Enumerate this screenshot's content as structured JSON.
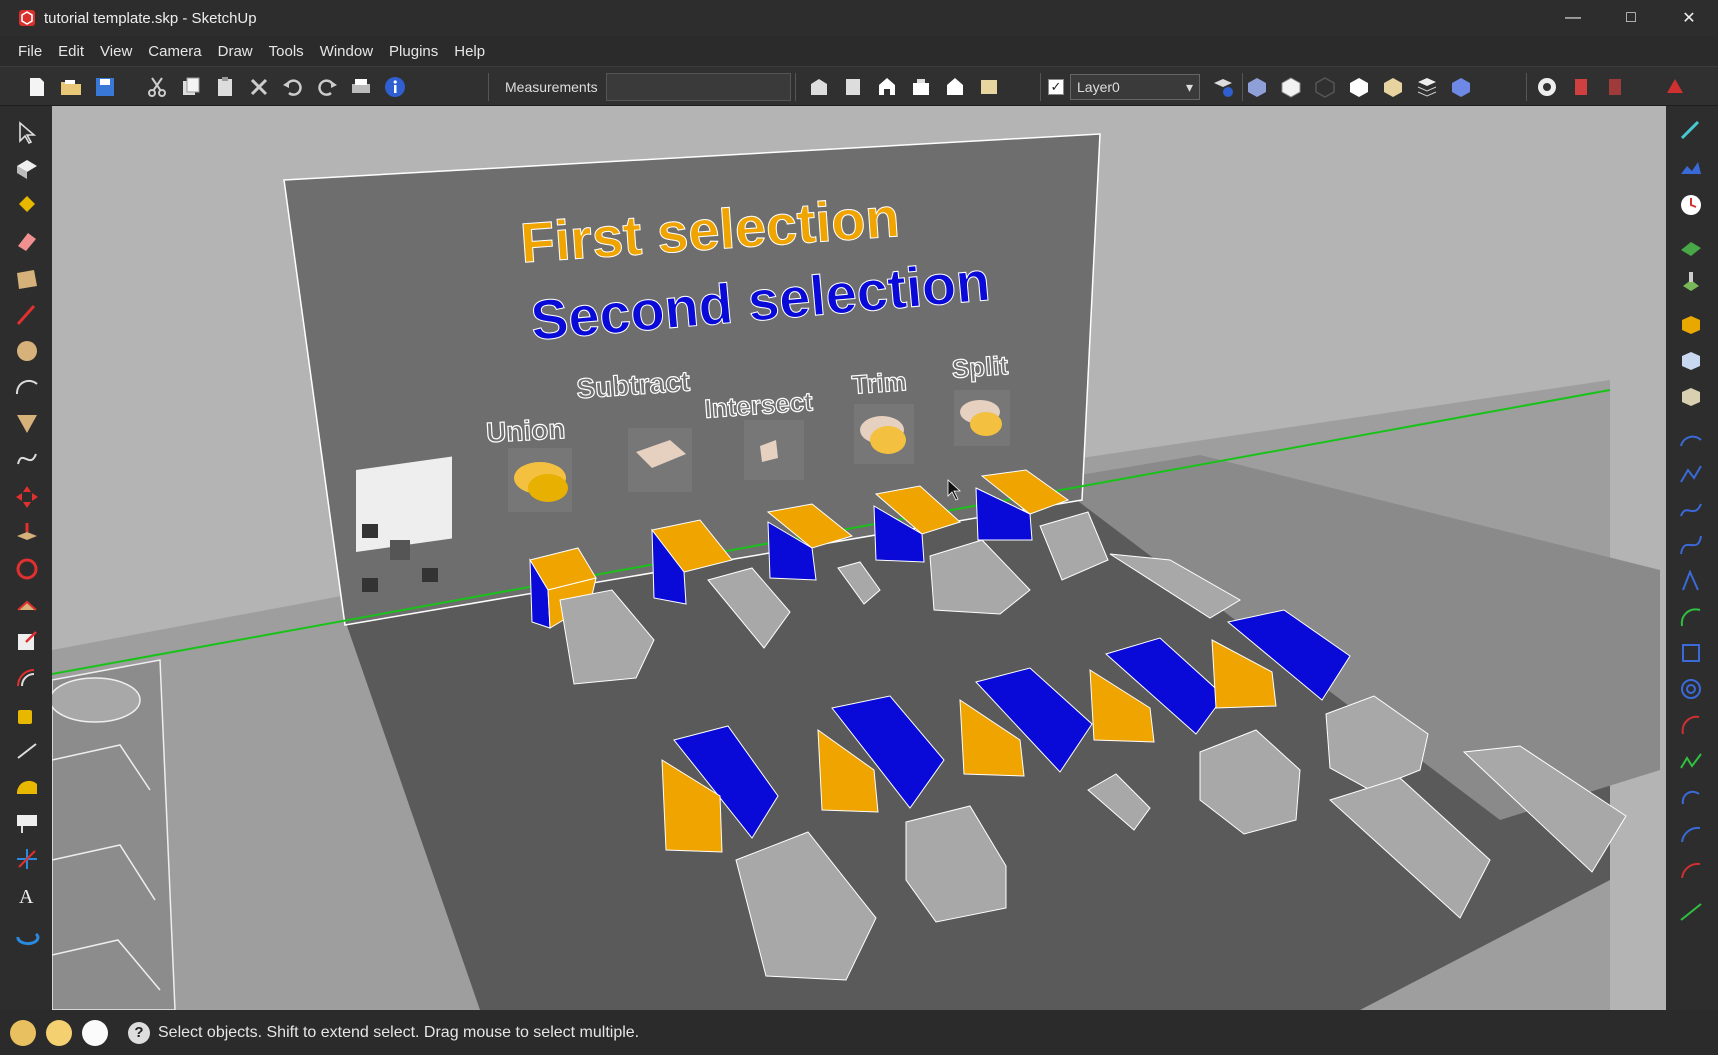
{
  "window": {
    "title": "tutorial template.skp - SketchUp",
    "minimize": "—",
    "maximize": "□",
    "close": "✕"
  },
  "menu": [
    "File",
    "Edit",
    "View",
    "Camera",
    "Draw",
    "Tools",
    "Window",
    "Plugins",
    "Help"
  ],
  "toolbar": {
    "measurements_label": "Measurements",
    "measurements_value": "",
    "layer_name": "Layer0",
    "layer_checked": true
  },
  "scene": {
    "heading1": "First selection",
    "heading2": "Second selection",
    "ops": [
      "Union",
      "Subtract",
      "Intersect",
      "Trim",
      "Split"
    ],
    "colors": {
      "first": "#f0a400",
      "second": "#0a0ad8",
      "wall": "#6e6e6e",
      "floor": "#5a5a5a",
      "solid": "#a8a8a8",
      "axis": "#19c219"
    }
  },
  "status": {
    "message": "Select objects. Shift to extend select. Drag mouse to select multiple."
  }
}
